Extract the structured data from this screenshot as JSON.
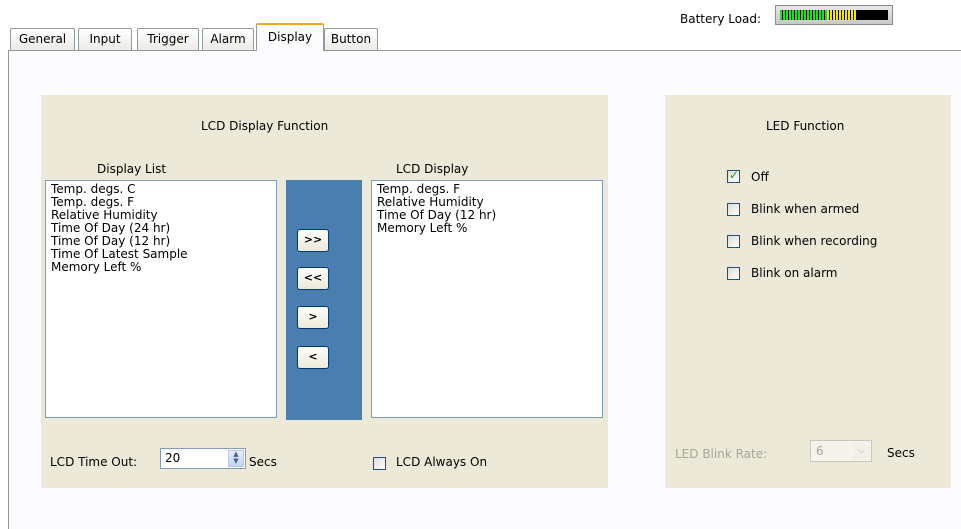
{
  "tabs": [
    {
      "label": "General"
    },
    {
      "label": "Input"
    },
    {
      "label": "Trigger"
    },
    {
      "label": "Alarm"
    },
    {
      "label": "Display"
    },
    {
      "label": "Button"
    }
  ],
  "battery": {
    "label": "Battery Load:",
    "level_fraction": 0.7
  },
  "lcd_group": {
    "title": "LCD Display Function",
    "display_list_label": "Display List",
    "lcd_display_label": "LCD Display",
    "display_list_items": [
      "Temp. degs. C",
      "Temp. degs. F",
      "Relative Humidity",
      "Time Of Day (24 hr)",
      "Time Of Day (12 hr)",
      "Time Of Latest Sample",
      "Memory Left %"
    ],
    "lcd_display_items": [
      "Temp. degs. F",
      "Relative Humidity",
      "Time Of Day (12 hr)",
      "Memory Left %"
    ],
    "buttons": {
      "add_all": ">>",
      "remove_all": "<<",
      "add": ">",
      "remove": "<"
    },
    "timeout_label": "LCD Time Out:",
    "timeout_value": "20",
    "timeout_unit": "Secs",
    "always_on_label": "LCD Always On",
    "always_on_checked": false
  },
  "led_group": {
    "title": "LED Function",
    "options": [
      {
        "label": "Off",
        "checked": true
      },
      {
        "label": "Blink when armed",
        "checked": false
      },
      {
        "label": "Blink when recording",
        "checked": false
      },
      {
        "label": "Blink on alarm",
        "checked": false
      }
    ],
    "blink_rate_label": "LED Blink Rate:",
    "blink_rate_value": "6",
    "blink_rate_unit": "Secs"
  },
  "colors": {
    "accent_tab": "#f5a623",
    "button_column": "#4a7eae",
    "group_bg": "#ece9d8"
  }
}
